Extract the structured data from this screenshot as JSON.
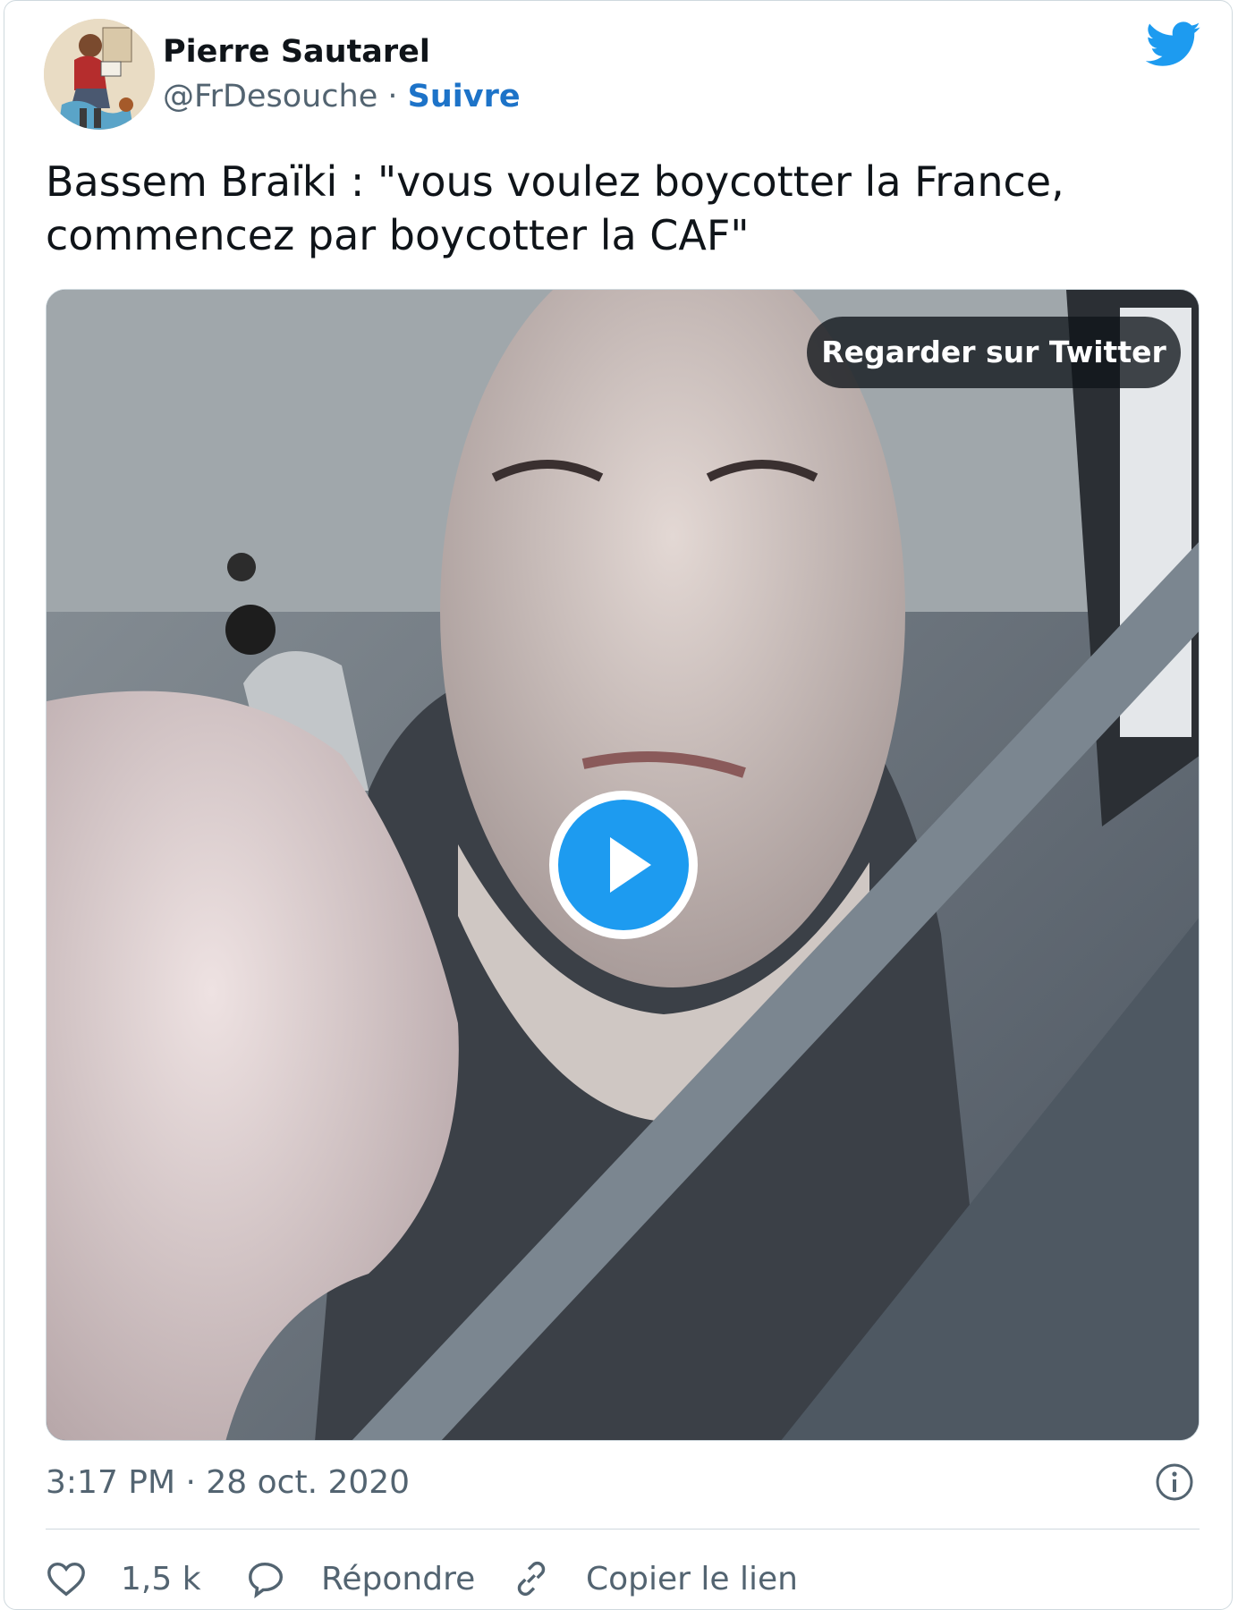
{
  "author": {
    "display_name": "Pierre Sautarel",
    "handle": "@FrDesouche",
    "separator": " · ",
    "follow_label": "Suivre"
  },
  "tweet": {
    "text_line1": "Bassem Braïki : \"vous voulez boycotter la France,",
    "text_line2": "commencez par boycotter la CAF\""
  },
  "media": {
    "watch_label": "Regarder sur Twitter",
    "type": "video"
  },
  "meta": {
    "timestamp": "3:17 PM · 28 oct. 2020"
  },
  "actions": {
    "like_count": "1,5 k",
    "reply_label": "Répondre",
    "copy_link_label": "Copier le lien"
  },
  "colors": {
    "twitter_blue": "#1d9bf0",
    "link_blue": "#1d73c8",
    "secondary_text": "#536471",
    "border": "#cfd9de"
  },
  "icons": [
    "twitter-bird-icon",
    "play-icon",
    "info-icon",
    "heart-icon",
    "reply-bubble-icon",
    "link-icon"
  ]
}
